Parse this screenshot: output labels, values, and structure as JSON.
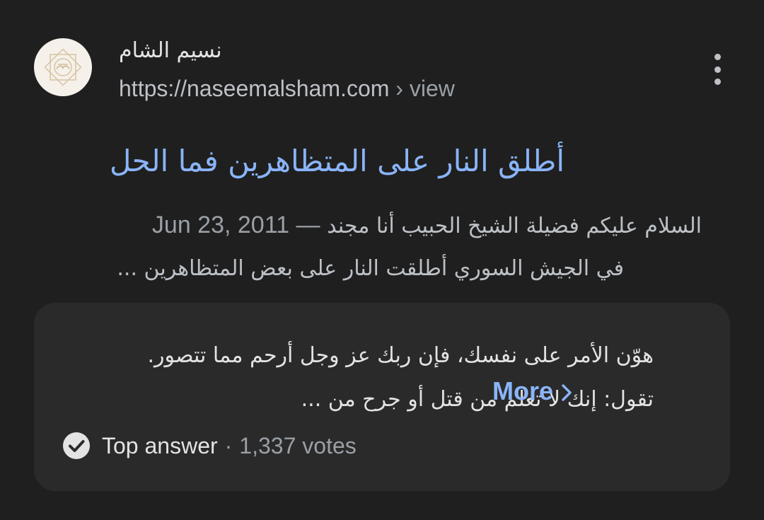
{
  "result": {
    "site_name": "نسيم الشام",
    "url": "https://naseemalsham.com",
    "breadcrumb": "› view",
    "title": "أطلق النار على المتظاهرين فما الحل",
    "favicon_icon": "site-logo-icon"
  },
  "snippet": {
    "date": "Jun 23, 2011",
    "dash": "—",
    "text_line1": "السلام عليكم فضيلة الشيخ الحبيب أنا مجند",
    "text_line2": "في الجيش السوري أطلقت النار على بعض المتظاهرين ..."
  },
  "answer": {
    "line1": "هوّن الأمر على نفسك، فإن ربك عز وجل أرحم مما تتصور.",
    "line2": "تقول: إنك لا تعلم من قتل أو جرح من ...",
    "more_label": "More",
    "badge_label": "Top answer",
    "separator": "·",
    "votes": "1,337 votes"
  },
  "colors": {
    "background": "#1f1f1f",
    "card": "#2a2a2a",
    "link": "#8ab4f8",
    "text": "#e3e3e3",
    "muted": "#9aa0a6"
  }
}
